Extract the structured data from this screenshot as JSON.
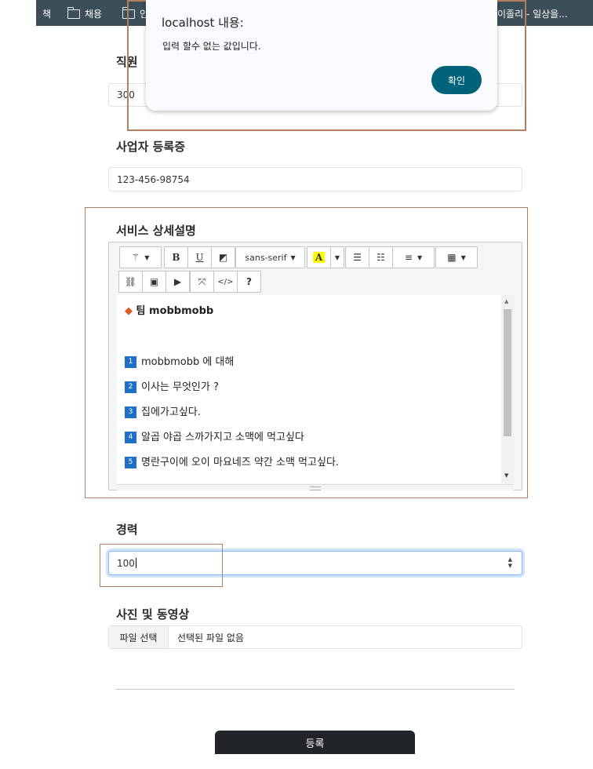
{
  "browser": {
    "bookmarks": [
      {
        "label": "책",
        "folder": false
      },
      {
        "label": "채용",
        "folder": true
      },
      {
        "label": "인",
        "folder": true
      },
      {
        "label": "이졸리 - 일상을...",
        "folder": false
      }
    ]
  },
  "dialog": {
    "title": "localhost 내용:",
    "message": "입력 할수 없는 값입니다.",
    "ok_label": "확인"
  },
  "form": {
    "staff_label": "직원",
    "staff_value": "300",
    "bizreg_label": "사업자 등록증",
    "bizreg_value": "123-456-98754",
    "service_label": "서비스 상세설명",
    "career_label": "경력",
    "career_value": "100",
    "media_label": "사진 및 동영상",
    "file_button": "파일 선택",
    "file_status": "선택된 파일 없음",
    "submit_label": "등록"
  },
  "editor": {
    "font_name": "sans-serif",
    "heading": "팀 mobbmobb",
    "items": [
      {
        "num": "1",
        "text": "mobbmobb 에 대해"
      },
      {
        "num": "2",
        "text": "이사는 무엇인가 ?"
      },
      {
        "num": "3",
        "text": "집에가고싶다."
      },
      {
        "num": "4",
        "text": "알곱 야곱 스까가지고 소맥에 먹고싶다"
      },
      {
        "num": "5",
        "text": "명란구이에 오이 마요네즈 약간 소맥 먹고싶다."
      }
    ]
  }
}
